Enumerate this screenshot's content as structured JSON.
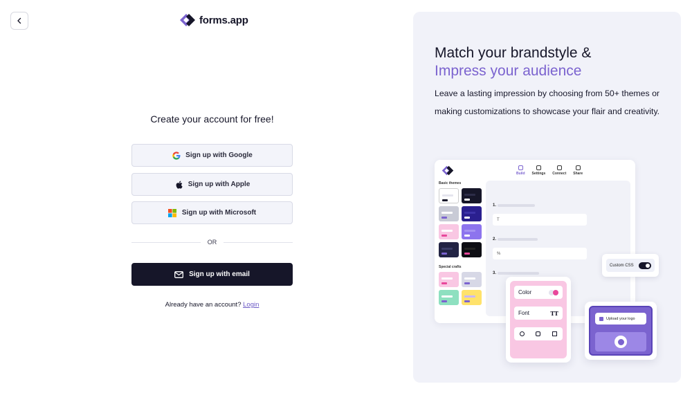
{
  "header": {
    "brand_name": "forms.app"
  },
  "signup": {
    "heading": "Create your account for free!",
    "google_label": "Sign up with Google",
    "apple_label": "Sign up with Apple",
    "microsoft_label": "Sign up with Microsoft",
    "divider_label": "OR",
    "email_label": "Sign up with email",
    "login_prompt": "Already have an account?",
    "login_link": "Login"
  },
  "promo": {
    "title_line1": "Match your brandstyle &",
    "title_line2": "Impress your audience",
    "description": "Leave a lasting impression by choosing from 50+ themes or making customizations to showcase your flair and creativity.",
    "accent_color": "#7b63cf",
    "mockup": {
      "tabs": [
        "Build",
        "Settings",
        "Connect",
        "Share"
      ],
      "basic_themes_label": "Basic themes",
      "special_crafts_label": "Special crafts",
      "questions": [
        {
          "number": "1.",
          "input_glyph": "T"
        },
        {
          "number": "2.",
          "input_glyph": "%"
        },
        {
          "number": "3.",
          "input_glyph": ""
        }
      ],
      "custom_css_label": "Custom CSS",
      "color_label": "Color",
      "font_label": "Font",
      "font_glyph": "TT",
      "upload_logo_label": "Upload your logo"
    }
  },
  "colors": {
    "primary_dark": "#161629",
    "button_light": "#f3f4fa",
    "panel_bg": "#f1f2f9",
    "link": "#6c5ac6"
  }
}
